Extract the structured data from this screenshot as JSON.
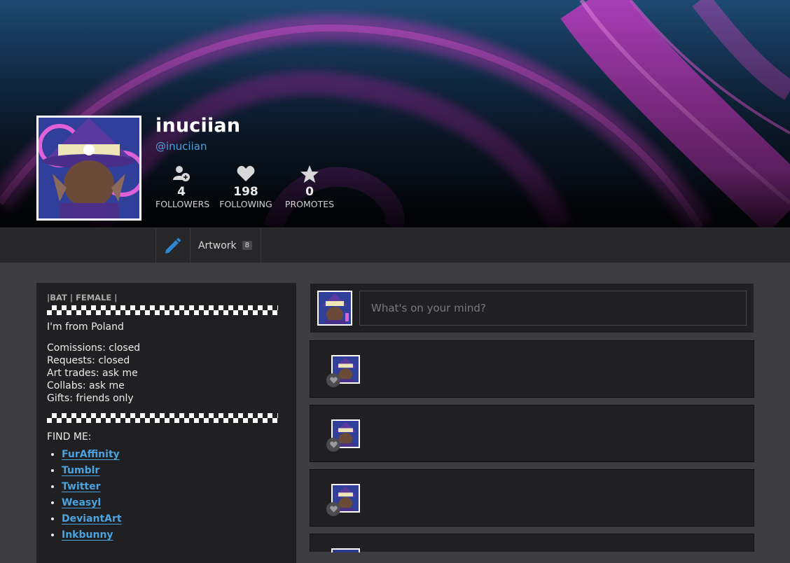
{
  "profile": {
    "username": "inuciian",
    "handle": "@inuciian",
    "avatar_icon": "avatar-image"
  },
  "stats": [
    {
      "icon": "add-user-icon",
      "value": "4",
      "label": "FOLLOWERS"
    },
    {
      "icon": "heart-icon",
      "value": "198",
      "label": "FOLLOWING"
    },
    {
      "icon": "star-icon",
      "value": "0",
      "label": "PROMOTES"
    }
  ],
  "tabs": {
    "edit_icon": "pencil-icon",
    "artwork_label": "Artwork",
    "artwork_count": "8"
  },
  "bio": {
    "tags": "|BAT | FEMALE |",
    "origin": "I'm from Poland",
    "status_lines": [
      "Comissions: closed",
      "Requests: closed",
      "Art trades: ask me",
      "Collabs: ask me",
      "Gifts: friends only"
    ],
    "find_me": "FIND ME:",
    "links": [
      "FurAffinity",
      "Tumblr",
      "Twitter",
      "Weasyl",
      "DeviantArt",
      "Inkbunny"
    ]
  },
  "compose": {
    "placeholder": "What's on your mind?"
  },
  "colors": {
    "accent": "#4aa3df",
    "panel": "#202022",
    "page": "#3d3d3f",
    "banner_magenta": "#c13cc2"
  }
}
